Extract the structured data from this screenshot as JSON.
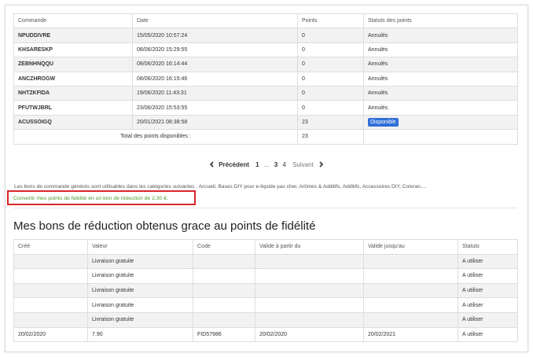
{
  "points_table": {
    "headers": [
      "Commande",
      "Date",
      "Points",
      "Statuts des points"
    ],
    "rows": [
      {
        "order": "NPUDDIVRE",
        "date": "15/05/2020 10:57:24",
        "points": "0",
        "status": "Annulés"
      },
      {
        "order": "KHSARESKP",
        "date": "08/06/2020 15:29:55",
        "points": "0",
        "status": "Annulés"
      },
      {
        "order": "ZEBNHNQQU",
        "date": "08/06/2020 16:14:44",
        "points": "0",
        "status": "Annulés"
      },
      {
        "order": "ANCZHROGW",
        "date": "08/06/2020 16:15:46",
        "points": "0",
        "status": "Annulés"
      },
      {
        "order": "NHTZKFIDA",
        "date": "19/06/2020 11:43:31",
        "points": "0",
        "status": "Annulés"
      },
      {
        "order": "PFUTWJBRL",
        "date": "23/06/2020 15:53:55",
        "points": "0",
        "status": "Annulés"
      },
      {
        "order": "ACUSSOIGQ",
        "date": "20/01/2021 08:38:58",
        "points": "23",
        "status_badge": "Disponible"
      }
    ],
    "total_label": "Total des points disponibles :",
    "total_value": "23"
  },
  "pagination": {
    "prev_label": "Précédent",
    "page1": "1",
    "ellipsis": "...",
    "page3": "3",
    "page4": "4",
    "next_label": "Suivant"
  },
  "info_text": "Les bons de commande générés sont utilisables dans les catégories suivantes : Accueil, Bases DIY pour e-liquide pas cher, Arômes & Additifs, Additifs, Accessoires DIY, Coloran....",
  "convert_link": "Convertir mes points de fidélité en un bon de réduction de 2,30 €.",
  "vouchers_title": "Mes bons de réduction obtenus grace au points de fidélité",
  "vouchers_table": {
    "headers": [
      "Créé",
      "Valeur",
      "Code",
      "Valide à partir du",
      "Valide jusqu'au",
      "Statuts"
    ],
    "rows": [
      {
        "created": "",
        "value": "Livraison gratuite",
        "code": "",
        "from": "",
        "to": "",
        "status": "A utiliser"
      },
      {
        "created": "",
        "value": "Livraison gratuite",
        "code": "",
        "from": "",
        "to": "",
        "status": "A utiliser"
      },
      {
        "created": "",
        "value": "Livraison gratuite",
        "code": "",
        "from": "",
        "to": "",
        "status": "A utiliser"
      },
      {
        "created": "",
        "value": "Livraison gratuite",
        "code": "",
        "from": "",
        "to": "",
        "status": "A utiliser"
      },
      {
        "created": "",
        "value": "Livraison gratuite",
        "code": "",
        "from": "",
        "to": "",
        "status": "A utiliser"
      },
      {
        "created": "20/02/2020",
        "value": "7.90",
        "code": "FID57986",
        "from": "20/02/2020",
        "to": "20/02/2021",
        "status": "A utiliser"
      }
    ]
  },
  "colors": {
    "badge": "#2f6fd6",
    "highlight_box": "#d9262c",
    "link_green": "#4c9a2a"
  }
}
